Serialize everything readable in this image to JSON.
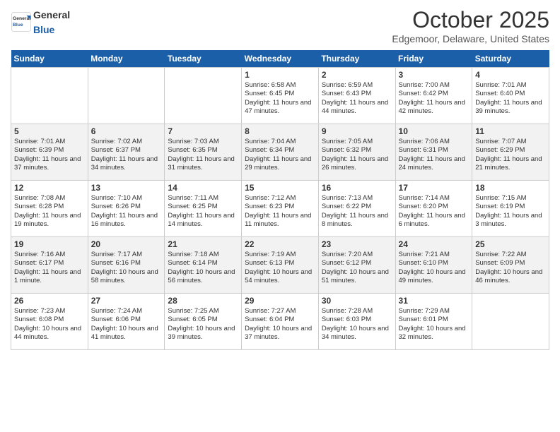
{
  "header": {
    "logo_general": "General",
    "logo_blue": "Blue",
    "month_title": "October 2025",
    "location": "Edgemoor, Delaware, United States"
  },
  "days_of_week": [
    "Sunday",
    "Monday",
    "Tuesday",
    "Wednesday",
    "Thursday",
    "Friday",
    "Saturday"
  ],
  "weeks": [
    [
      {
        "day": "",
        "content": ""
      },
      {
        "day": "",
        "content": ""
      },
      {
        "day": "",
        "content": ""
      },
      {
        "day": "1",
        "content": "Sunrise: 6:58 AM\nSunset: 6:45 PM\nDaylight: 11 hours and 47 minutes."
      },
      {
        "day": "2",
        "content": "Sunrise: 6:59 AM\nSunset: 6:43 PM\nDaylight: 11 hours and 44 minutes."
      },
      {
        "day": "3",
        "content": "Sunrise: 7:00 AM\nSunset: 6:42 PM\nDaylight: 11 hours and 42 minutes."
      },
      {
        "day": "4",
        "content": "Sunrise: 7:01 AM\nSunset: 6:40 PM\nDaylight: 11 hours and 39 minutes."
      }
    ],
    [
      {
        "day": "5",
        "content": "Sunrise: 7:01 AM\nSunset: 6:39 PM\nDaylight: 11 hours and 37 minutes."
      },
      {
        "day": "6",
        "content": "Sunrise: 7:02 AM\nSunset: 6:37 PM\nDaylight: 11 hours and 34 minutes."
      },
      {
        "day": "7",
        "content": "Sunrise: 7:03 AM\nSunset: 6:35 PM\nDaylight: 11 hours and 31 minutes."
      },
      {
        "day": "8",
        "content": "Sunrise: 7:04 AM\nSunset: 6:34 PM\nDaylight: 11 hours and 29 minutes."
      },
      {
        "day": "9",
        "content": "Sunrise: 7:05 AM\nSunset: 6:32 PM\nDaylight: 11 hours and 26 minutes."
      },
      {
        "day": "10",
        "content": "Sunrise: 7:06 AM\nSunset: 6:31 PM\nDaylight: 11 hours and 24 minutes."
      },
      {
        "day": "11",
        "content": "Sunrise: 7:07 AM\nSunset: 6:29 PM\nDaylight: 11 hours and 21 minutes."
      }
    ],
    [
      {
        "day": "12",
        "content": "Sunrise: 7:08 AM\nSunset: 6:28 PM\nDaylight: 11 hours and 19 minutes."
      },
      {
        "day": "13",
        "content": "Sunrise: 7:10 AM\nSunset: 6:26 PM\nDaylight: 11 hours and 16 minutes."
      },
      {
        "day": "14",
        "content": "Sunrise: 7:11 AM\nSunset: 6:25 PM\nDaylight: 11 hours and 14 minutes."
      },
      {
        "day": "15",
        "content": "Sunrise: 7:12 AM\nSunset: 6:23 PM\nDaylight: 11 hours and 11 minutes."
      },
      {
        "day": "16",
        "content": "Sunrise: 7:13 AM\nSunset: 6:22 PM\nDaylight: 11 hours and 8 minutes."
      },
      {
        "day": "17",
        "content": "Sunrise: 7:14 AM\nSunset: 6:20 PM\nDaylight: 11 hours and 6 minutes."
      },
      {
        "day": "18",
        "content": "Sunrise: 7:15 AM\nSunset: 6:19 PM\nDaylight: 11 hours and 3 minutes."
      }
    ],
    [
      {
        "day": "19",
        "content": "Sunrise: 7:16 AM\nSunset: 6:17 PM\nDaylight: 11 hours and 1 minute."
      },
      {
        "day": "20",
        "content": "Sunrise: 7:17 AM\nSunset: 6:16 PM\nDaylight: 10 hours and 58 minutes."
      },
      {
        "day": "21",
        "content": "Sunrise: 7:18 AM\nSunset: 6:14 PM\nDaylight: 10 hours and 56 minutes."
      },
      {
        "day": "22",
        "content": "Sunrise: 7:19 AM\nSunset: 6:13 PM\nDaylight: 10 hours and 54 minutes."
      },
      {
        "day": "23",
        "content": "Sunrise: 7:20 AM\nSunset: 6:12 PM\nDaylight: 10 hours and 51 minutes."
      },
      {
        "day": "24",
        "content": "Sunrise: 7:21 AM\nSunset: 6:10 PM\nDaylight: 10 hours and 49 minutes."
      },
      {
        "day": "25",
        "content": "Sunrise: 7:22 AM\nSunset: 6:09 PM\nDaylight: 10 hours and 46 minutes."
      }
    ],
    [
      {
        "day": "26",
        "content": "Sunrise: 7:23 AM\nSunset: 6:08 PM\nDaylight: 10 hours and 44 minutes."
      },
      {
        "day": "27",
        "content": "Sunrise: 7:24 AM\nSunset: 6:06 PM\nDaylight: 10 hours and 41 minutes."
      },
      {
        "day": "28",
        "content": "Sunrise: 7:25 AM\nSunset: 6:05 PM\nDaylight: 10 hours and 39 minutes."
      },
      {
        "day": "29",
        "content": "Sunrise: 7:27 AM\nSunset: 6:04 PM\nDaylight: 10 hours and 37 minutes."
      },
      {
        "day": "30",
        "content": "Sunrise: 7:28 AM\nSunset: 6:03 PM\nDaylight: 10 hours and 34 minutes."
      },
      {
        "day": "31",
        "content": "Sunrise: 7:29 AM\nSunset: 6:01 PM\nDaylight: 10 hours and 32 minutes."
      },
      {
        "day": "",
        "content": ""
      }
    ]
  ]
}
